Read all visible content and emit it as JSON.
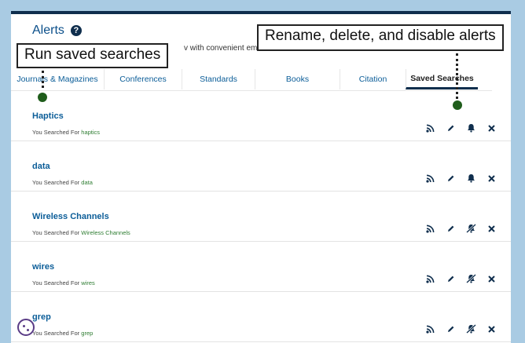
{
  "header": {
    "title": "Alerts",
    "help_icon": "?",
    "description_fragment": "v with convenient emai"
  },
  "tabs": [
    {
      "label": "Journals & Magazines",
      "active": false
    },
    {
      "label": "Conferences",
      "active": false
    },
    {
      "label": "Standards",
      "active": false
    },
    {
      "label": "Books",
      "active": false
    },
    {
      "label": "Citation",
      "active": false
    },
    {
      "label": "Saved Searches",
      "active": true
    }
  ],
  "searches": [
    {
      "name": "Haptics",
      "prefix": "You Searched For",
      "term": "haptics",
      "alerts_enabled": true
    },
    {
      "name": "data",
      "prefix": "You Searched For",
      "term": "data",
      "alerts_enabled": true
    },
    {
      "name": "Wireless Channels",
      "prefix": "You Searched For",
      "term": "Wireless Channels",
      "alerts_enabled": false
    },
    {
      "name": "wires",
      "prefix": "You Searched For",
      "term": "wires",
      "alerts_enabled": false
    },
    {
      "name": "grep",
      "prefix": "You Searched For",
      "term": "grep",
      "alerts_enabled": false
    }
  ],
  "icons": {
    "rss": "rss-icon",
    "edit": "pencil-icon",
    "alert_on": "bell-icon",
    "alert_off": "bell-off-icon",
    "delete": "close-icon",
    "cookie": "cookie-icon"
  },
  "callouts": {
    "left": "Run saved searches",
    "right": "Rename, delete, and disable alerts"
  },
  "colors": {
    "background": "#a9cbe3",
    "header_bar": "#0f2e4d",
    "link": "#0b5d98",
    "term": "#2e7d32",
    "marker": "#1f5d1b"
  }
}
